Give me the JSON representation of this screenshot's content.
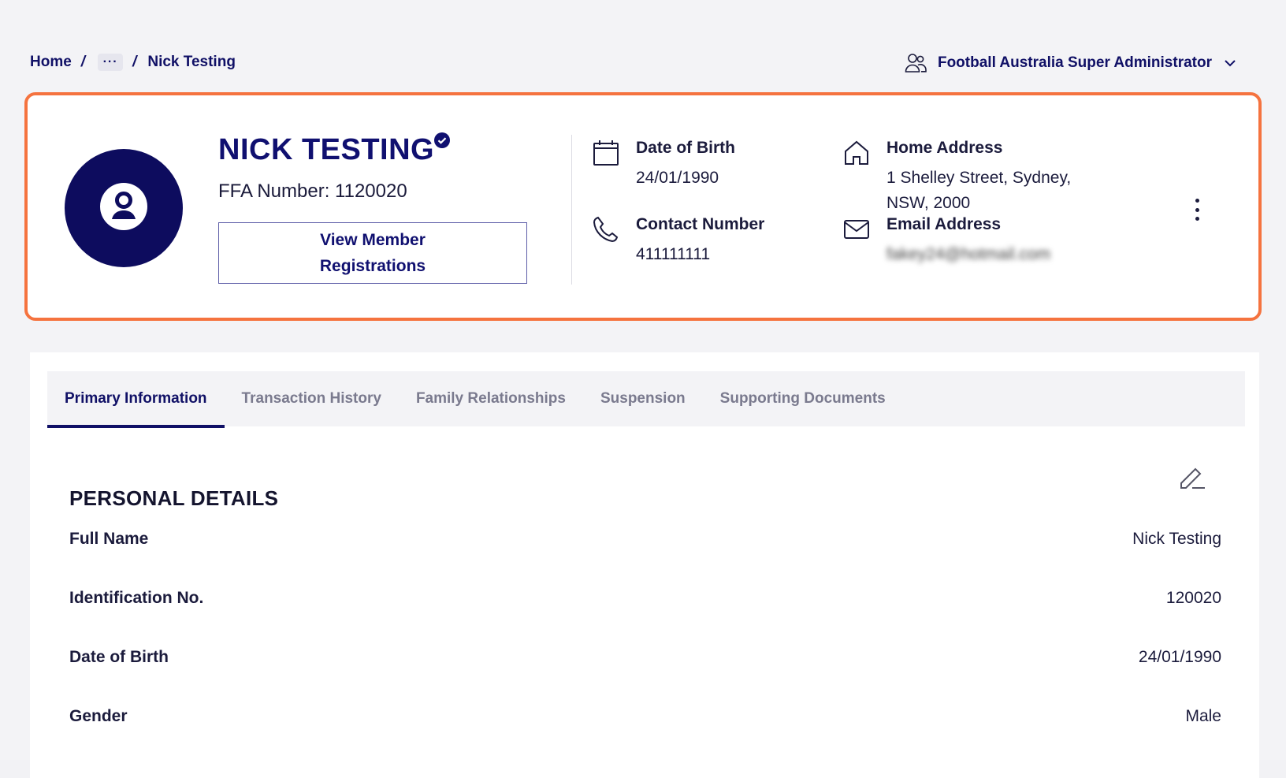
{
  "breadcrumb": {
    "home": "Home",
    "separator": "/",
    "ellipsis": "···",
    "current": "Nick Testing"
  },
  "user_menu": {
    "role": "Football Australia Super Administrator",
    "icon": "user-group-icon",
    "chevron": "chevron-down-icon"
  },
  "profile": {
    "name": "NICK TESTING",
    "verified_icon": "verified-badge-icon",
    "ffa_label": "FFA Number:",
    "ffa_number": "1120020",
    "view_button": "View Member Registrations",
    "dob_label": "Date of Birth",
    "dob_value": "24/01/1990",
    "contact_label": "Contact Number",
    "contact_value": "411111111",
    "address_label": "Home Address",
    "address_line1": "1 Shelley Street, Sydney,",
    "address_line2": "NSW, 2000",
    "email_label": "Email Address",
    "email_value": "fakey24@hotmail.com"
  },
  "tabs": [
    {
      "label": "Primary Information",
      "active": true
    },
    {
      "label": "Transaction History",
      "active": false
    },
    {
      "label": "Family Relationships",
      "active": false
    },
    {
      "label": "Suspension",
      "active": false
    },
    {
      "label": "Supporting Documents",
      "active": false
    }
  ],
  "personal_details": {
    "title": "PERSONAL DETAILS",
    "rows": [
      {
        "label": "Full Name",
        "value": "Nick Testing"
      },
      {
        "label": "Identification No.",
        "value": "120020"
      },
      {
        "label": "Date of Birth",
        "value": "24/01/1990"
      },
      {
        "label": "Gender",
        "value": "Male"
      }
    ]
  },
  "colors": {
    "accent_border": "#f5733f",
    "brand_navy": "#101066",
    "avatar_bg": "#0d0c5e"
  }
}
